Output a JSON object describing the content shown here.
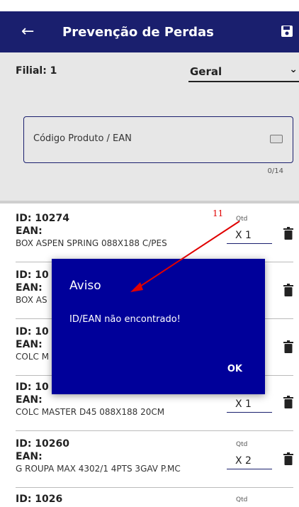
{
  "appbar": {
    "title": "Prevenção de Perdas",
    "back_icon": "arrow-left-icon",
    "save_icon": "floppy-disk-icon"
  },
  "filial": {
    "label": "Filial: 1",
    "select_value": "Geral",
    "select_icon": "chevron-down-icon"
  },
  "search": {
    "placeholder": "Código Produto / EAN",
    "counter": "0/14",
    "icon": "keyboard-icon"
  },
  "items": [
    {
      "id": "ID: 10274",
      "ean": "EAN:",
      "desc": "BOX ASPEN SPRING 088X188 C/PES",
      "qtd_label": "Qtd",
      "qtd": "X  1"
    },
    {
      "id": "ID: 10",
      "ean": "EAN:",
      "desc": "BOX AS",
      "qtd_label": "",
      "qtd": ""
    },
    {
      "id": "ID: 10",
      "ean": "EAN:",
      "desc": "COLC M",
      "qtd_label": "",
      "qtd": ""
    },
    {
      "id": "ID: 10",
      "ean": "EAN:",
      "desc": "COLC MASTER D45 088X188 20CM",
      "qtd_label": "",
      "qtd": "X  1"
    },
    {
      "id": "ID: 10260",
      "ean": "EAN:",
      "desc": "G ROUPA MAX 4302/1 4PTS 3GAV P.MC",
      "qtd_label": "Qtd",
      "qtd": "X  2"
    },
    {
      "id": "ID: 1026",
      "ean": "",
      "desc": "",
      "qtd_label": "Qtd",
      "qtd": ""
    }
  ],
  "dialog": {
    "title": "Aviso",
    "message": "ID/EAN não encontrado!",
    "ok_label": "OK"
  },
  "annotation": {
    "number": "11",
    "color": "#e00000"
  },
  "colors": {
    "appbar": "#1a1f6e",
    "dialog": "#00009a",
    "panel": "#e7e7e7"
  }
}
